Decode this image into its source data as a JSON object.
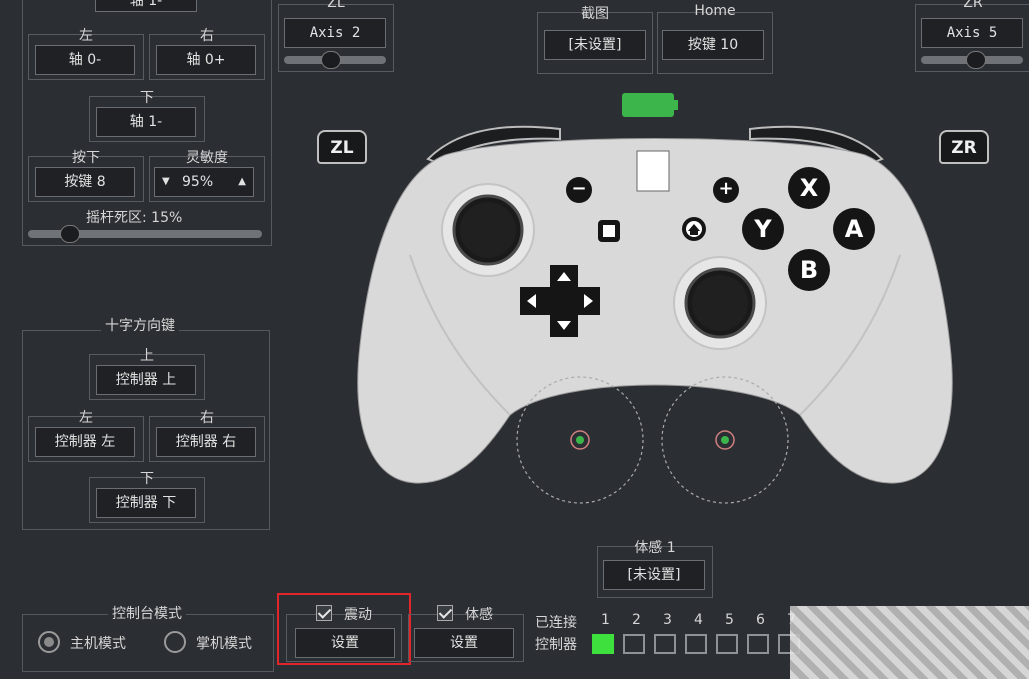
{
  "left_stick": {
    "top_value": "轴 1-",
    "left_label": "左",
    "left_value": "轴 0-",
    "right_label": "右",
    "right_value": "轴 0+",
    "down_label": "下",
    "down_value": "轴 1-",
    "press_label": "按下",
    "press_value": "按键 8",
    "sensitivity_label": "灵敏度",
    "sensitivity_value": "95%",
    "deadzone_label": "摇杆死区: 15%",
    "deadzone_fraction": 0.15
  },
  "zl": {
    "label": "ZL",
    "value": "Axis 2",
    "slider_fraction": 0.45
  },
  "zr": {
    "label": "ZR",
    "value": "Axis 5",
    "slider_fraction": 0.55
  },
  "capture": {
    "label": "截图",
    "value": "[未设置]"
  },
  "home": {
    "label": "Home",
    "value": "按键 10"
  },
  "dpad": {
    "title": "十字方向键",
    "up_label": "上",
    "up_value": "控制器 上",
    "left_label": "左",
    "left_value": "控制器 左",
    "right_label": "右",
    "right_value": "控制器 右",
    "down_label": "下",
    "down_value": "控制器 下"
  },
  "controller": {
    "zl_badge": "ZL",
    "zr_badge": "ZR",
    "minus": "−",
    "plus": "+",
    "btn_x": "X",
    "btn_y": "Y",
    "btn_a": "A",
    "btn_b": "B",
    "battery_color": "#3cb64a"
  },
  "motion1": {
    "label": "体感 1",
    "value": "[未设置]"
  },
  "console_mode": {
    "title": "控制台模式",
    "host_label": "主机模式",
    "handheld_label": "掌机模式",
    "selected": "host"
  },
  "vibration": {
    "label": "震动",
    "checked": true,
    "button": "设置"
  },
  "motion": {
    "label": "体感",
    "checked": true,
    "button": "设置"
  },
  "connection": {
    "connected_label": "已连接",
    "controller_label": "控制器",
    "numbers": [
      "1",
      "2",
      "3",
      "4",
      "5",
      "6",
      "7"
    ],
    "active_index": 0,
    "active_color": "#3ee03e"
  },
  "highlight_color": "#e0262a"
}
